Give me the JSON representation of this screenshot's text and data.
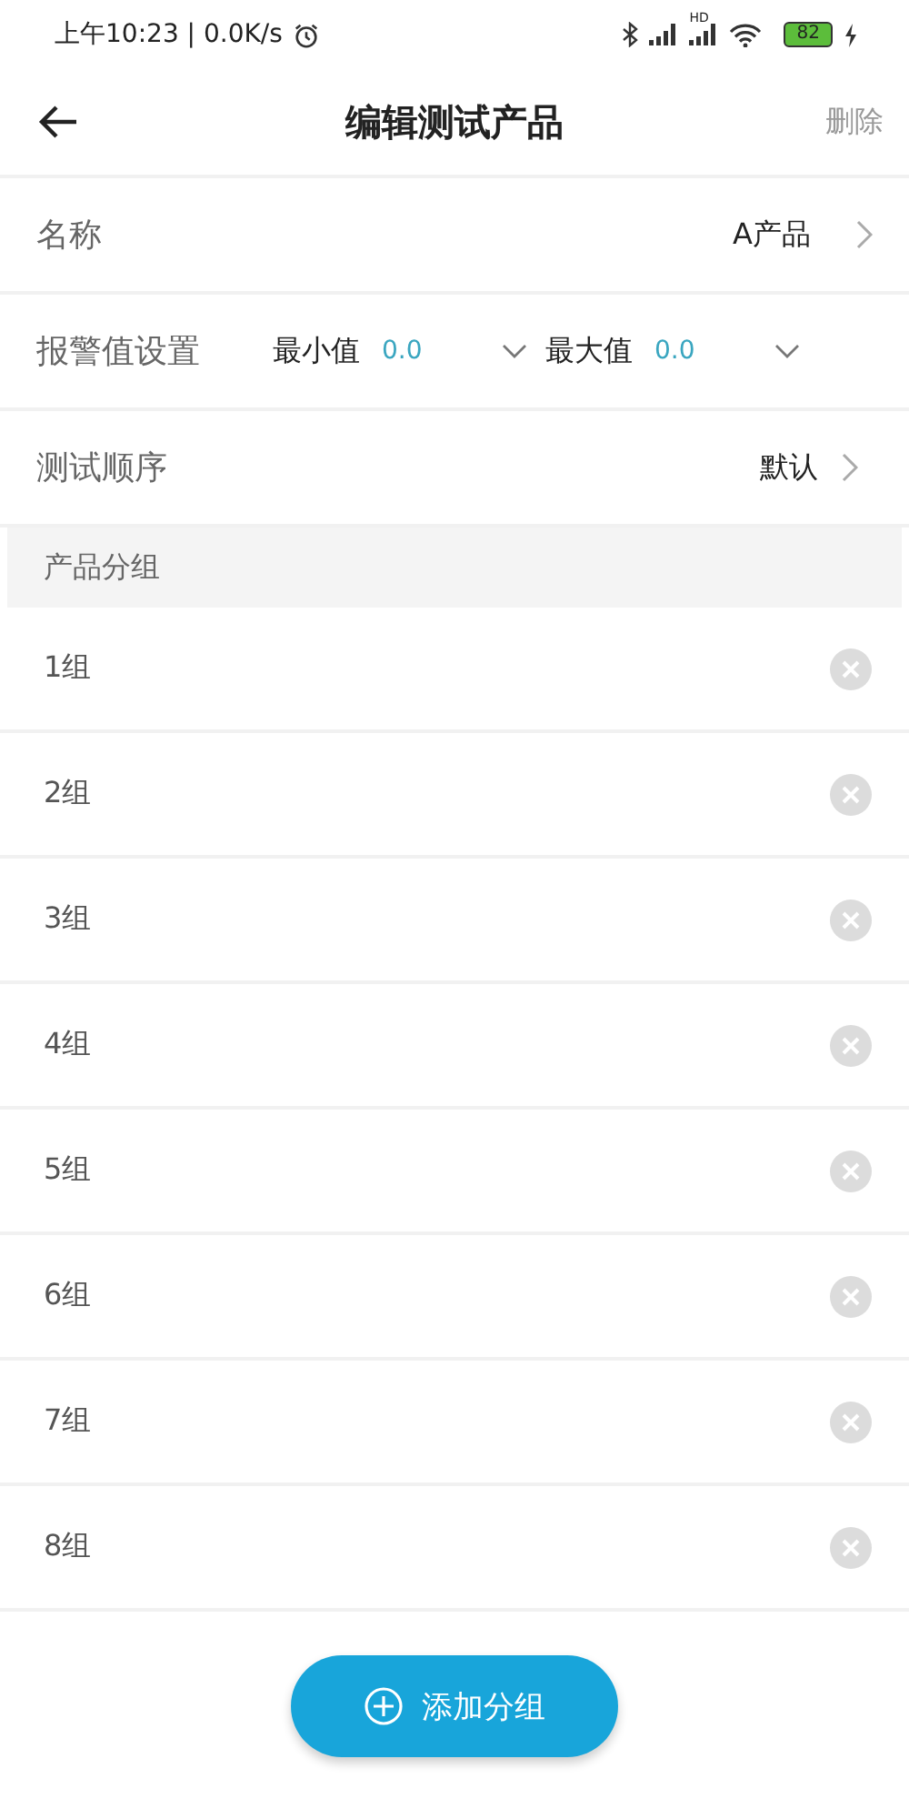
{
  "status_bar": {
    "time": "上午10:23",
    "separator": "|",
    "speed": "0.0K/s",
    "network_label": "HD",
    "battery": "82"
  },
  "header": {
    "title": "编辑测试产品",
    "action": "删除"
  },
  "name_row": {
    "label": "名称",
    "value": "A产品"
  },
  "alarm_row": {
    "label": "报警值设置",
    "min_label": "最小值",
    "min_value": "0.0",
    "max_label": "最大值",
    "max_value": "0.0"
  },
  "order_row": {
    "label": "测试顺序",
    "value": "默认"
  },
  "groups": {
    "title": "产品分组",
    "items": [
      {
        "name": "1组"
      },
      {
        "name": "2组"
      },
      {
        "name": "3组"
      },
      {
        "name": "4组"
      },
      {
        "name": "5组"
      },
      {
        "name": "6组"
      },
      {
        "name": "7组"
      },
      {
        "name": "8组"
      }
    ]
  },
  "add_button": "添加分组"
}
